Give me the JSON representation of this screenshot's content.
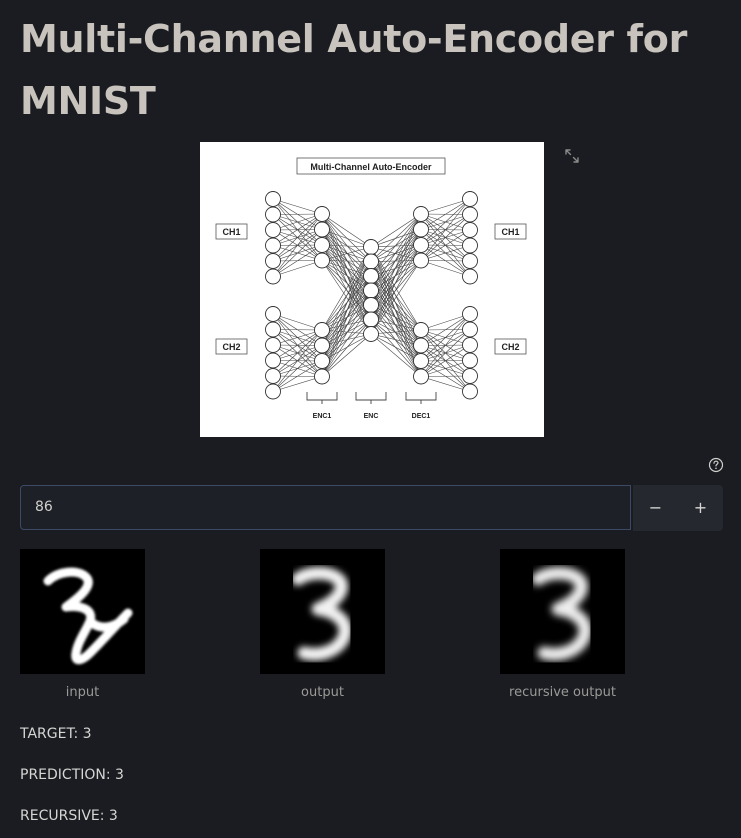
{
  "page": {
    "title": "Multi-Channel Auto-Encoder for MNIST"
  },
  "diagram": {
    "title": "Multi-Channel Auto-Encoder",
    "labels": {
      "ch1_left": "CH1",
      "ch2_left": "CH2",
      "ch1_right": "CH1",
      "ch2_right": "CH2",
      "enc1": "ENC1",
      "enc": "ENC",
      "dec1": "DEC1"
    }
  },
  "toolbar": {
    "expand_icon": "expand-icon",
    "help_icon": "help-circle-icon"
  },
  "number_input": {
    "value": "86",
    "minus_label": "−",
    "plus_label": "+"
  },
  "images": {
    "input_caption": "input",
    "output_caption": "output",
    "recursive_caption": "recursive output"
  },
  "results": {
    "target": "TARGET: 3",
    "prediction": "PREDICTION: 3",
    "recursive": "RECURSIVE: 3"
  }
}
